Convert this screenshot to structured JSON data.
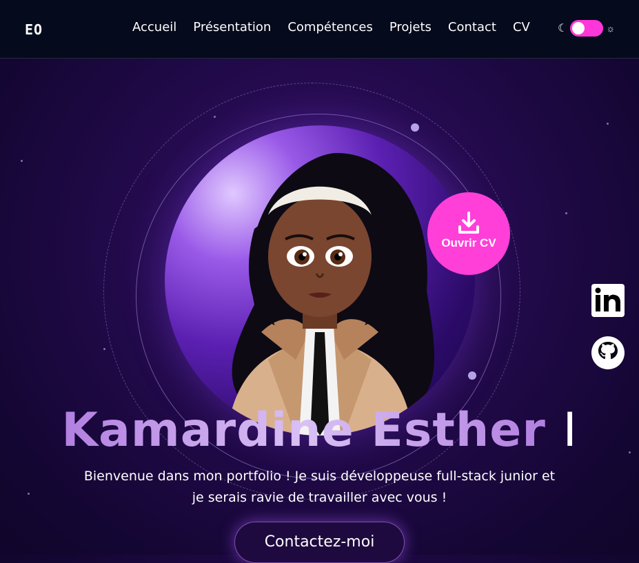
{
  "header": {
    "logo": "EO",
    "nav": [
      "Accueil",
      "Présentation",
      "Compétences",
      "Projets",
      "Contact",
      "CV"
    ],
    "theme_toggle": {
      "state": "dark",
      "accent": "#ff36d9"
    }
  },
  "hero": {
    "cv_badge_label": "Ouvrir CV",
    "name": "Kamardine Esther",
    "cursor": "I",
    "intro_line1": "Bienvenue dans mon portfolio ! Je suis développeuse full-stack junior et",
    "intro_line2": "je serais ravie de travailler avec vous !",
    "cta_label": "Contactez-moi"
  },
  "social": {
    "linkedin_label": "in"
  },
  "colors": {
    "background": "#1a0840",
    "header_bg": "#050a1c",
    "badge": "#ff3fd8",
    "name_gradient_start": "#b27fe0",
    "name_gradient_mid": "#d9c0f5"
  },
  "icons": [
    "moon-icon",
    "sun-icon",
    "download-icon",
    "linkedin-icon",
    "github-icon"
  ]
}
